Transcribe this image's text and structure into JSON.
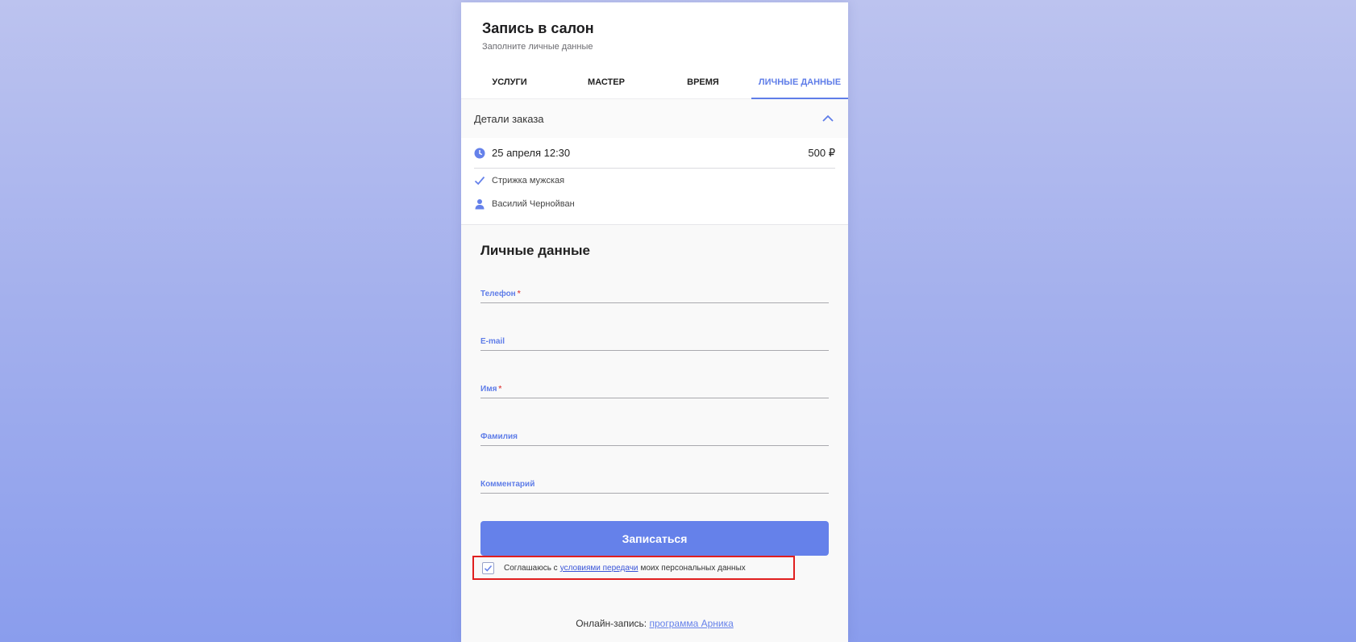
{
  "header": {
    "title": "Запись в салон",
    "subtitle": "Заполните личные данные"
  },
  "tabs": [
    {
      "label": "УСЛУГИ",
      "active": false
    },
    {
      "label": "МАСТЕР",
      "active": false
    },
    {
      "label": "ВРЕМЯ",
      "active": false
    },
    {
      "label": "ЛИЧНЫЕ ДАННЫЕ",
      "active": true
    }
  ],
  "order_details": {
    "title": "Детали заказа",
    "datetime": "25 апреля 12:30",
    "price": "500 ₽",
    "service": "Стрижка мужская",
    "master": "Василий Чернойван",
    "icons": {
      "collapse": "chevron-up-icon",
      "datetime": "clock-icon",
      "service": "check-icon",
      "master": "person-icon"
    }
  },
  "form": {
    "title": "Личные данные",
    "fields": [
      {
        "label": "Телефон",
        "required": "*",
        "value": ""
      },
      {
        "label": "E-mail",
        "required": "",
        "value": ""
      },
      {
        "label": "Имя",
        "required": "*",
        "value": ""
      },
      {
        "label": "Фамилия",
        "required": "",
        "value": ""
      },
      {
        "label": "Комментарий",
        "required": "",
        "value": ""
      }
    ],
    "submit_label": "Записаться"
  },
  "consent": {
    "checked": true,
    "before": "Соглашаюсь с",
    "link": "условиями передачи",
    "after": "моих персональных данных"
  },
  "footer": {
    "text": "Онлайн-запись:",
    "link": "программа Арника"
  },
  "colors": {
    "accent": "#6581ea",
    "required": "#e05555",
    "highlight_border": "#e01f1f"
  }
}
